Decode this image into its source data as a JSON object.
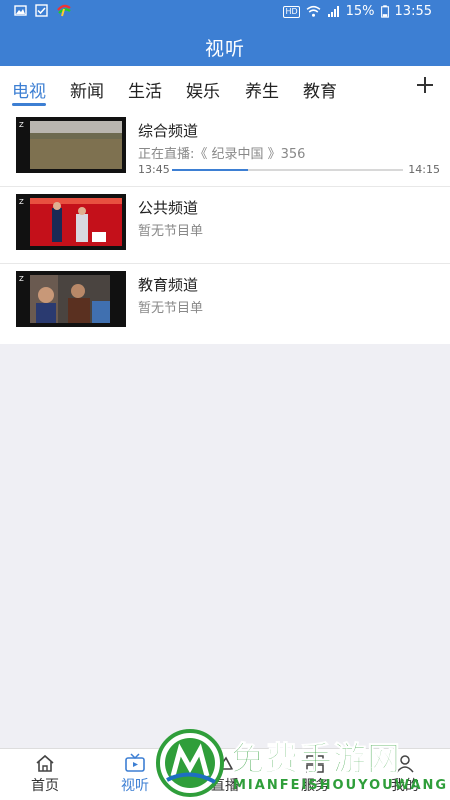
{
  "status": {
    "battery": "15%",
    "time": "13:55",
    "network": "HD"
  },
  "header": {
    "title": "视听"
  },
  "tabs": [
    {
      "label": "电视",
      "active": true
    },
    {
      "label": "新闻"
    },
    {
      "label": "生活"
    },
    {
      "label": "娱乐"
    },
    {
      "label": "养生"
    },
    {
      "label": "教育"
    }
  ],
  "channels": [
    {
      "name": "综合频道",
      "subtitle": "正在直播:《 纪录中国 》356",
      "start": "13:45",
      "end": "14:15",
      "progress": 0.33
    },
    {
      "name": "公共频道",
      "subtitle": "暂无节目单"
    },
    {
      "name": "教育频道",
      "subtitle": "暂无节目单"
    }
  ],
  "bottom_nav": [
    {
      "label": "首页",
      "icon": "home-icon"
    },
    {
      "label": "视听",
      "icon": "tv-icon",
      "active": true
    },
    {
      "label": "直播",
      "icon": "live-icon"
    },
    {
      "label": "服务",
      "icon": "service-icon"
    },
    {
      "label": "我的",
      "icon": "profile-icon"
    }
  ],
  "watermark": {
    "title": "免费手游网",
    "subtitle": "MIANFEISHOUYOUWANG"
  },
  "colors": {
    "accent": "#3d7fd3",
    "watermark": "#2f9e3a"
  }
}
